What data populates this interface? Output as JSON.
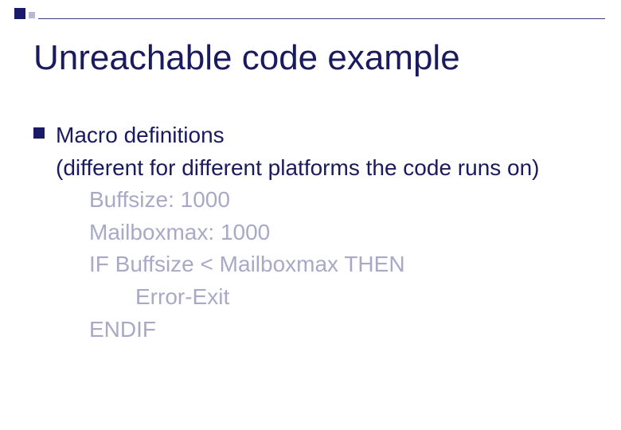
{
  "slide": {
    "title": "Unreachable code example",
    "bullet": {
      "heading": "Macro definitions",
      "subheading": "(different for different platforms the code runs on)",
      "code": {
        "l1": "Buffsize: 1000",
        "l2": "Mailboxmax: 1000",
        "l3": "IF Buffsize < Mailboxmax THEN",
        "l4": "Error-Exit",
        "l5": "ENDIF"
      }
    }
  }
}
